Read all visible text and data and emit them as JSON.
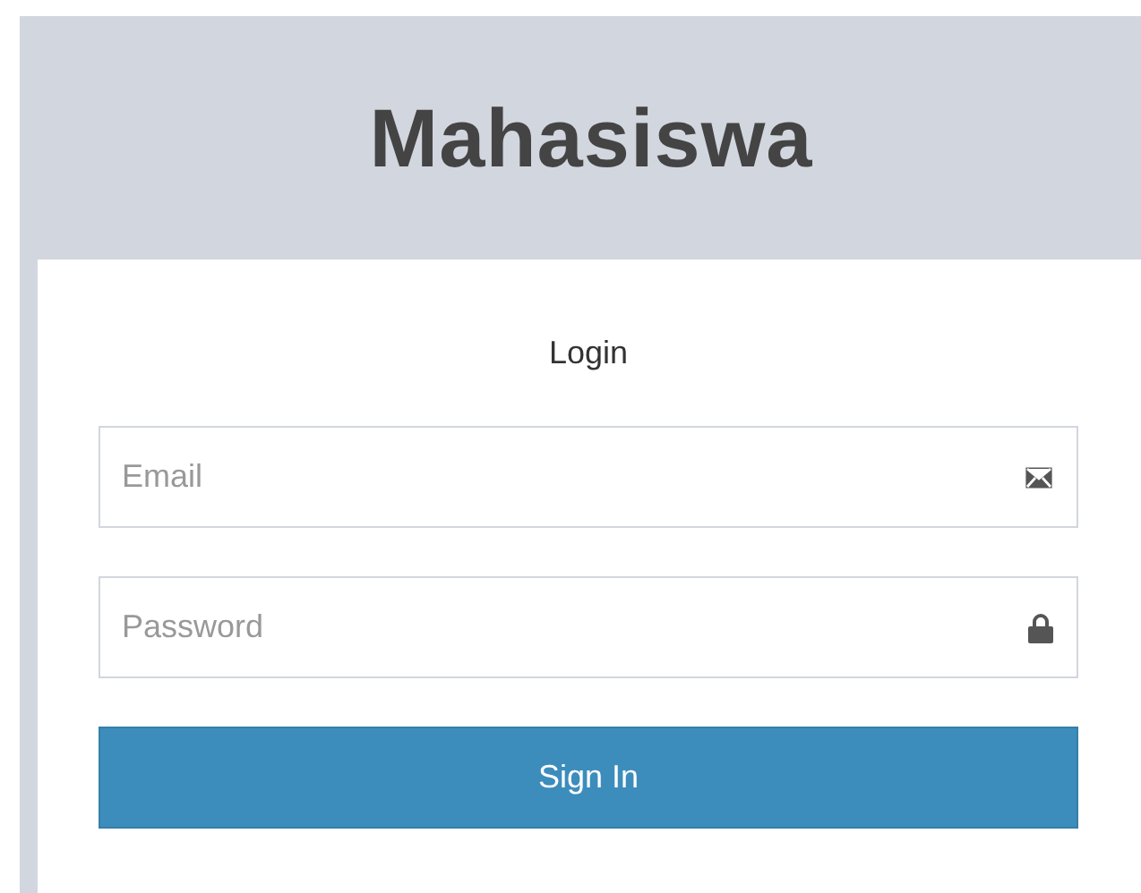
{
  "title": "Mahasiswa",
  "login_box": {
    "heading": "Login",
    "fields": [
      {
        "kind": "email",
        "placeholder": "Email"
      },
      {
        "kind": "password",
        "placeholder": "Password"
      }
    ],
    "button": "Sign In"
  }
}
